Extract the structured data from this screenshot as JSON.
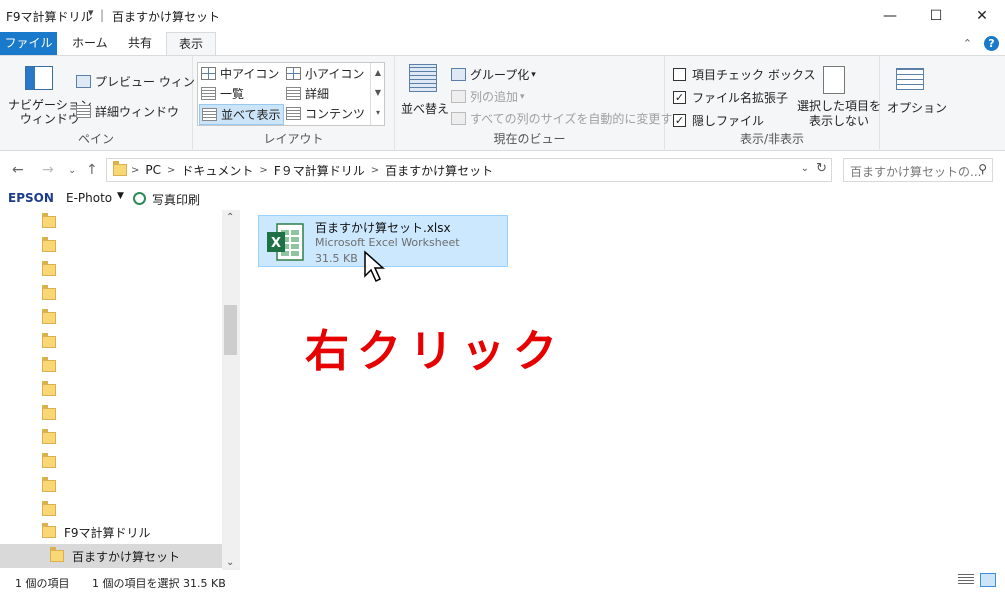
{
  "titlebar": {
    "quick_access_title": "F9マ計算ドリル",
    "qa_arrow": "▾",
    "separator": "|",
    "window_title": "百ますかけ算セット",
    "minimize": "—",
    "maximize": "☐",
    "close": "✕"
  },
  "tabs": {
    "file": "ファイル",
    "home": "ホーム",
    "share": "共有",
    "view": "表示"
  },
  "ribbon": {
    "pane": {
      "nav_pane": "ナビゲーション\nウィンドウ",
      "preview": "プレビュー ウィンドウ",
      "details": "詳細ウィンドウ",
      "label": "ペイン"
    },
    "layout": {
      "medium_icons": "中アイコン",
      "small_icons": "小アイコン",
      "list": "一覧",
      "details": "詳細",
      "tiles": "並べて表示",
      "content": "コンテンツ",
      "label": "レイアウト"
    },
    "current_view": {
      "sort": "並べ替え",
      "group": "グループ化",
      "add_column": "列の追加",
      "fit_columns": "すべての列のサイズを自動的に変更する",
      "label": "現在のビュー"
    },
    "show_hide": {
      "item_checkbox": "項目チェック ボックス",
      "extensions": "ファイル名拡張子",
      "hidden": "隠しファイル",
      "hide_selected": "選択した項目を\n表示しない",
      "label": "表示/非表示",
      "extensions_checked": "✓",
      "hidden_checked": "✓"
    },
    "options": "オプション"
  },
  "address": {
    "segments": [
      "PC",
      "ドキュメント",
      "F９マ計算ドリル",
      "百ますかけ算セット"
    ],
    "search_placeholder": "百ますかけ算セットの..."
  },
  "epson": {
    "brand": "EPSON",
    "app": "E-Photo",
    "print": "写真印刷"
  },
  "tree": {
    "parent": "F9マ計算ドリル",
    "current": "百ますかけ算セット"
  },
  "file": {
    "name": "百ますかけ算セット.xlsx",
    "type": "Microsoft Excel Worksheet",
    "size": "31.5 KB",
    "icon_letter": "X"
  },
  "annotation": "右クリック",
  "status": {
    "count": "1 個の項目",
    "selected": "1 個の項目を選択  31.5 KB"
  }
}
